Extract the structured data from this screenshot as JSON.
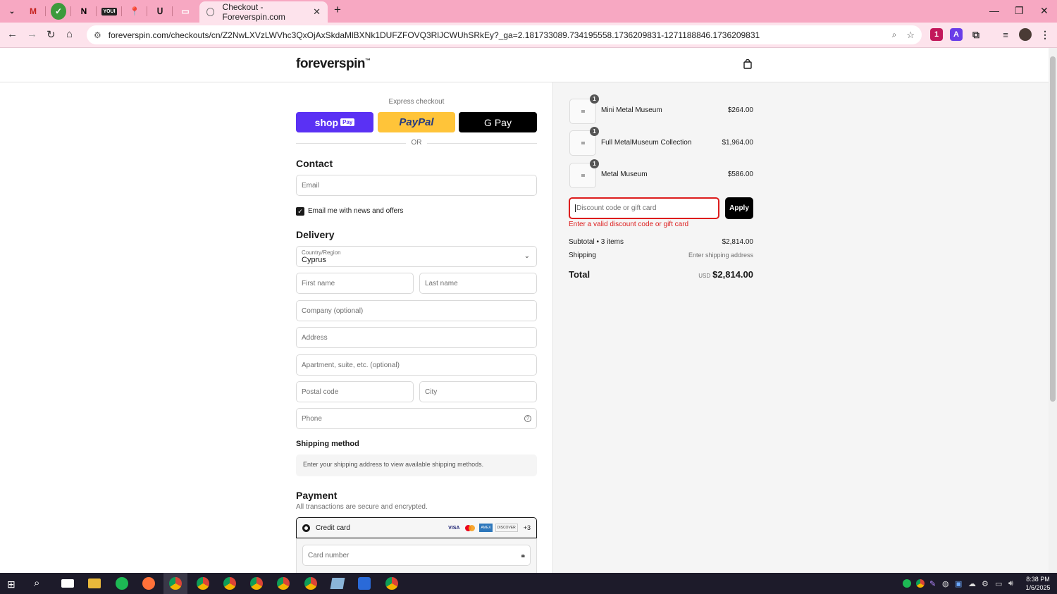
{
  "browser": {
    "pinned_tabs": [
      "M",
      "✓",
      "N",
      "YOUI",
      "📍",
      "ᑌ",
      "▭"
    ],
    "active_tab_title": "Checkout - Foreverspin.com",
    "new_tab": "+",
    "url": "foreverspin.com/checkouts/cn/Z2NwLXVzLWVhc3QxOjAxSkdaMlBXNk1DUFZFOVQ3RlJCWUhSRkEy?_ga=2.181733089.734195558.1736209831-1271188846.1736209831",
    "window_controls": {
      "minimize": "—",
      "restore": "❐",
      "close": "✕"
    },
    "ext_badge": "1",
    "ext_a": "A"
  },
  "site": {
    "logo": "foreverspin",
    "logo_tm": "™"
  },
  "express": {
    "label": "Express checkout",
    "shop_pay": "shop",
    "shop_pay_badge": "Pay",
    "paypal": "PayPal",
    "gpay": "G Pay",
    "or": "OR"
  },
  "contact": {
    "heading": "Contact",
    "email_placeholder": "Email",
    "newsletter_label": "Email me with news and offers",
    "newsletter_checked": true
  },
  "delivery": {
    "heading": "Delivery",
    "country_label": "Country/Region",
    "country_value": "Cyprus",
    "first_name": "First name",
    "last_name": "Last name",
    "company": "Company (optional)",
    "address": "Address",
    "apartment": "Apartment, suite, etc. (optional)",
    "postal": "Postal code",
    "city": "City",
    "phone": "Phone"
  },
  "shipping_method": {
    "heading": "Shipping method",
    "notice": "Enter your shipping address to view available shipping methods."
  },
  "payment": {
    "heading": "Payment",
    "subtitle": "All transactions are secure and encrypted.",
    "method_label": "Credit card",
    "cards": [
      "VISA",
      "MC",
      "AMEX",
      "DISCOVER"
    ],
    "more_cards": "+3",
    "card_number": "Card number"
  },
  "order": {
    "items": [
      {
        "qty": "1",
        "name": "Mini Metal Museum",
        "price": "$264.00"
      },
      {
        "qty": "1",
        "name": "Full MetalMuseum Collection",
        "price": "$1,964.00"
      },
      {
        "qty": "1",
        "name": "Metal Museum",
        "price": "$586.00"
      }
    ],
    "discount_placeholder": "Discount code or gift card",
    "apply": "Apply",
    "discount_error": "Enter a valid discount code or gift card",
    "subtotal_label": "Subtotal • 3 items",
    "subtotal_value": "$2,814.00",
    "shipping_label": "Shipping",
    "shipping_value": "Enter shipping address",
    "total_label": "Total",
    "currency": "USD",
    "total_value": "$2,814.00"
  },
  "taskbar": {
    "time": "8:38 PM",
    "date": "1/6/2025"
  },
  "colors": {
    "tab_strip": "#f7a8c2",
    "toolbar": "#fde3ec",
    "shop_pay": "#5a31f4",
    "paypal": "#ffc439",
    "error": "#dd1d1d"
  }
}
